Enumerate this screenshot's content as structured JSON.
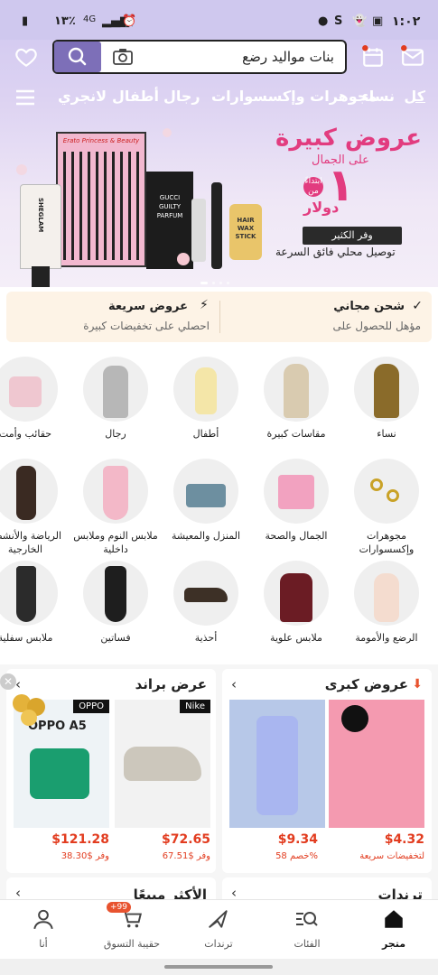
{
  "status_bar": {
    "time": "١:٠٢",
    "battery": "١٣٪",
    "network": "4G"
  },
  "header": {
    "search_text": "بنات مواليد رضع",
    "category_tabs": [
      "كل",
      "نساء",
      "مجوهرات وإكسسوارات",
      "رجال",
      "أطفال",
      "لانجري"
    ]
  },
  "banner": {
    "title": "عروض كبيرة",
    "subtitle": "على الجمال",
    "price_prefix": "ابتداءً من",
    "price": "١",
    "currency": "دولار",
    "button": "وفر الكثير",
    "delivery": "توصيل محلي فائق السرعة",
    "products": [
      "SHEGLAM",
      "GUCCI GUILTY PARFUM",
      "HAIR WAX STICK",
      "Erato Princess & Beauty"
    ]
  },
  "benefits": {
    "free_shipping": {
      "title": "شحن مجاني",
      "subtitle": "مؤهل للحصول على"
    },
    "flash_deals": {
      "title": "عروض سريعة",
      "subtitle": "احصلي على تخفيضات كبيرة"
    }
  },
  "categories": [
    {
      "label": "نساء",
      "icon": "woman-dress-icon"
    },
    {
      "label": "مقاسات كبيرة",
      "icon": "plus-size-icon"
    },
    {
      "label": "أطفال",
      "icon": "kid-dress-icon"
    },
    {
      "label": "رجال",
      "icon": "man-icon"
    },
    {
      "label": "حقائب وأمت",
      "icon": "bag-icon"
    },
    {
      "label": "مجوهرات وإكسسوارات",
      "icon": "rings-icon"
    },
    {
      "label": "الجمال والصحة",
      "icon": "beauty-icon"
    },
    {
      "label": "المنزل والمعيشة",
      "icon": "home-icon"
    },
    {
      "label": "ملابس النوم وملابس داخلية",
      "icon": "sleepwear-icon"
    },
    {
      "label": "الرياضة والأنشطة الخارجية",
      "icon": "sport-icon"
    },
    {
      "label": "الرضع والأمومة",
      "icon": "baby-icon"
    },
    {
      "label": "ملابس علوية",
      "icon": "top-icon"
    },
    {
      "label": "أحذية",
      "icon": "shoe-icon"
    },
    {
      "label": "فساتين",
      "icon": "dress-icon"
    },
    {
      "label": "ملابس سفلية",
      "icon": "bottoms-icon"
    }
  ],
  "deals": {
    "big_deals": {
      "title": "عروض كبرى",
      "items": [
        {
          "price": "$4.32",
          "sub": "لتخفيضات سريعة"
        },
        {
          "price": "$9.34",
          "sub": "خصم 58%"
        }
      ]
    },
    "brand_deals": {
      "title": "عرض براند",
      "items": [
        {
          "brand": "Nike",
          "price": "$72.65",
          "sub": "وفر $67.51"
        },
        {
          "brand": "OPPO",
          "price": "$121.28",
          "sub": "وفر $38.30",
          "product": "OPPO A5"
        }
      ]
    }
  },
  "more_sections": {
    "trends": "ترندات",
    "best_sellers": "الأكثر مبيعًا"
  },
  "bottom_nav": {
    "items": [
      {
        "label": "متجر",
        "icon": "store-icon",
        "active": true
      },
      {
        "label": "الفئات",
        "icon": "categories-icon",
        "active": false
      },
      {
        "label": "ترندات",
        "icon": "trends-icon",
        "active": false
      },
      {
        "label": "حقيبة التسوق",
        "icon": "cart-icon",
        "active": false,
        "badge": "+99"
      },
      {
        "label": "أنا",
        "icon": "profile-icon",
        "active": false
      }
    ]
  },
  "colors": {
    "accent": "#7d6fb8",
    "price": "#e23c1f",
    "promo": "#e23c7f",
    "badge": "#e8532f"
  }
}
